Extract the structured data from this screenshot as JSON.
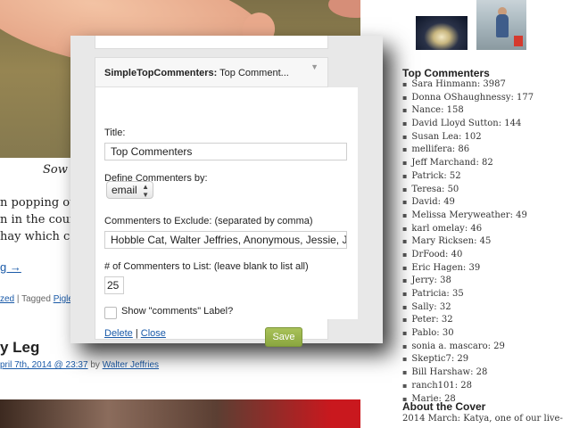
{
  "post": {
    "caption": "Sow o",
    "paragraph_lines": [
      "n popping out",
      "n in the court y",
      "hay which com"
    ],
    "continue_link": "g →",
    "meta_prefix": "zed",
    "meta_sep": " | Tagged ",
    "meta_tag": "Piglets",
    "next_title": "y Leg",
    "next_date": "pril 7th, 2014 @ 23:37",
    "next_by": " by ",
    "next_author": "Walter Jeffries"
  },
  "widget": {
    "title_bold": "SimpleTopCommenters:",
    "title_rest": " Top Comment...",
    "title_label": "Title:",
    "title_value": "Top Commenters",
    "define_label": "Define Commenters by:",
    "define_value": "email",
    "exclude_label": "Commenters to Exclude: (separated by comma)",
    "exclude_value": "Hobble Cat, Walter Jeffries, Anonymous, Jessie, Jay",
    "count_label": "# of Commenters to List: (leave blank to list all)",
    "count_value": "25",
    "show_label": "Show \"comments\" Label?",
    "delete_label": "Delete",
    "separator": " | ",
    "close_label": "Close",
    "save_label": "Save"
  },
  "sidebar": {
    "heading": "Top Commenters",
    "commenters": [
      "Sara Hinmann: 3987",
      "Donna OShaughnessy: 177",
      "Nance: 158",
      "David Lloyd Sutton: 144",
      "Susan Lea: 102",
      "mellifera: 86",
      "Jeff Marchand: 82",
      "Patrick: 52",
      "Teresa: 50",
      "David: 49",
      "Melissa Meryweather: 49",
      "karl omelay: 46",
      "Mary Ricksen: 45",
      "DrFood: 40",
      "Eric Hagen: 39",
      "Jerry: 38",
      "Patricia: 35",
      "Sally: 32",
      "Peter: 32",
      "Pablo: 30",
      "sonia a. mascaro: 29",
      "Skeptic7: 29",
      "Bill Harshaw: 28",
      "ranch101: 28",
      "Marie: 28"
    ],
    "cover_heading": "About the Cover",
    "cover_text": "2014 March: Katya, one of our live-"
  },
  "colors": {
    "link": "#1a5aa8",
    "save_button": "#8aa63f"
  }
}
